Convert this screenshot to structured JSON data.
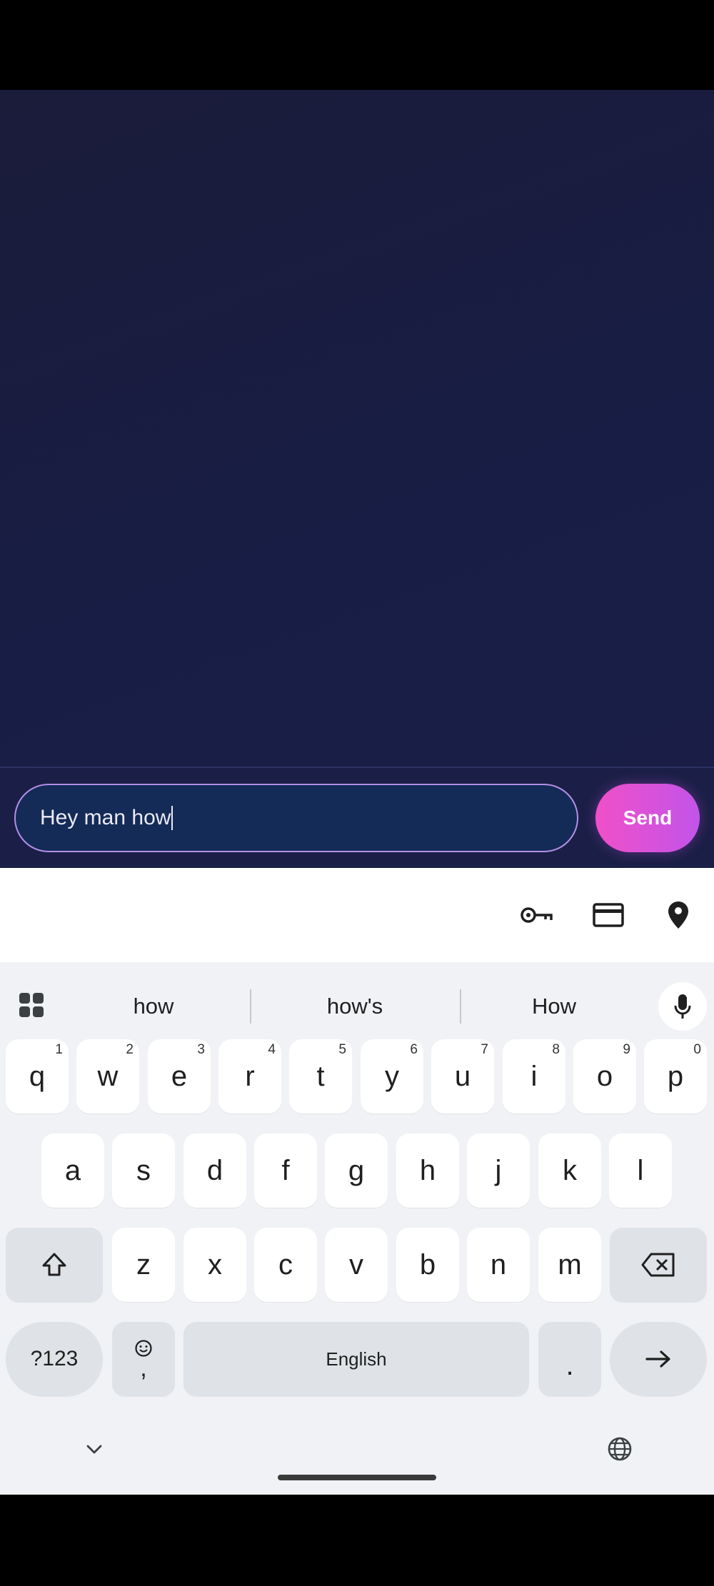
{
  "composer": {
    "input_text": "Hey man how",
    "send_label": "Send"
  },
  "keyboard": {
    "autofill_icons": [
      "key-icon",
      "credit-card-icon",
      "location-pin-icon"
    ],
    "suggestions": [
      "how",
      "how's",
      "How"
    ],
    "rows": {
      "row1": [
        {
          "k": "q",
          "h": "1"
        },
        {
          "k": "w",
          "h": "2"
        },
        {
          "k": "e",
          "h": "3"
        },
        {
          "k": "r",
          "h": "4"
        },
        {
          "k": "t",
          "h": "5"
        },
        {
          "k": "y",
          "h": "6"
        },
        {
          "k": "u",
          "h": "7"
        },
        {
          "k": "i",
          "h": "8"
        },
        {
          "k": "o",
          "h": "9"
        },
        {
          "k": "p",
          "h": "0"
        }
      ],
      "row2": [
        "a",
        "s",
        "d",
        "f",
        "g",
        "h",
        "j",
        "k",
        "l"
      ],
      "row3": [
        "z",
        "x",
        "c",
        "v",
        "b",
        "n",
        "m"
      ]
    },
    "symbols_label": "?123",
    "comma_label": ",",
    "space_label": "English",
    "period_label": ".",
    "enter_icon": "arrow-right-icon"
  },
  "colors": {
    "accent_gradient_start": "#f050c8",
    "accent_gradient_end": "#c254e9",
    "input_border": "#b48fe6",
    "app_background": "#181d45"
  }
}
